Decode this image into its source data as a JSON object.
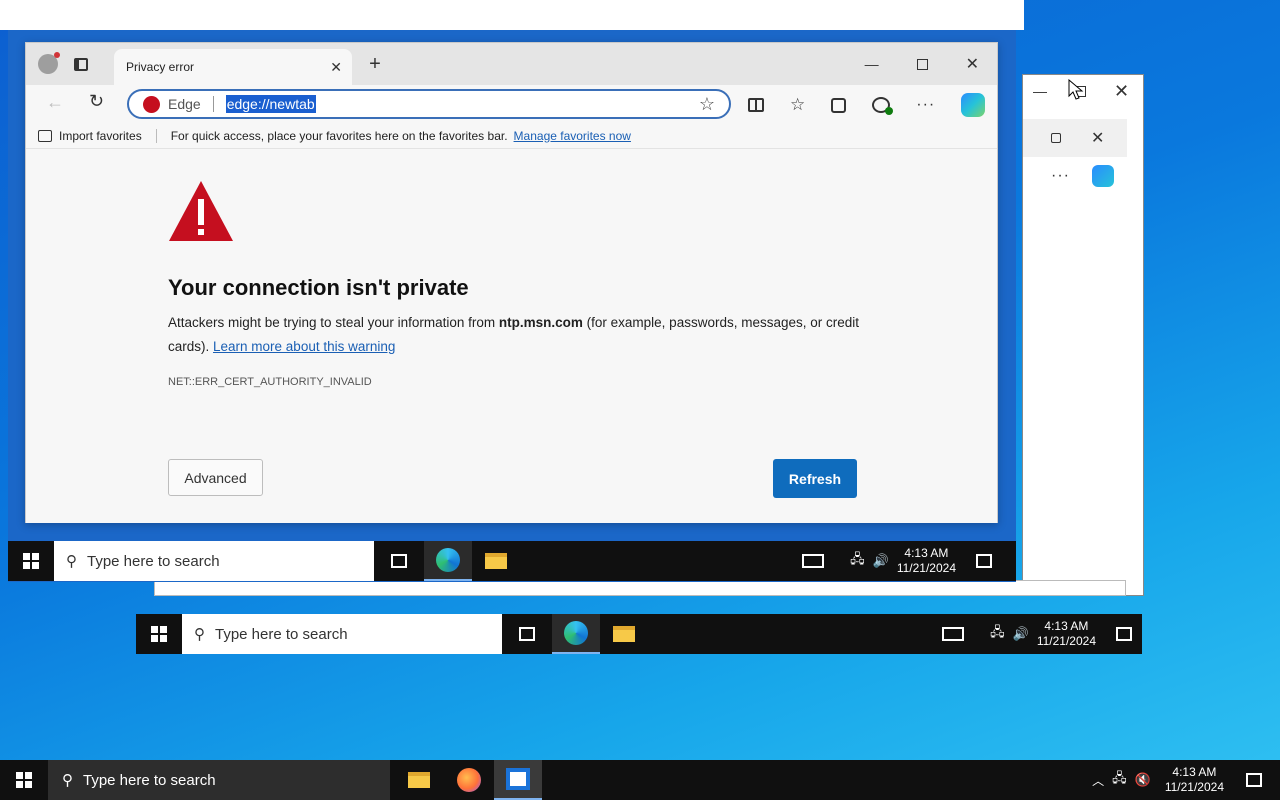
{
  "taskbars": {
    "search_placeholder": "Type here to search",
    "time": "4:13 AM",
    "date": "11/21/2024"
  },
  "browser": {
    "tab_title": "Privacy error",
    "site_label": "Edge",
    "url": "edge://newtab",
    "favbar": {
      "import_label": "Import favorites",
      "hint": "For quick access, place your favorites here on the favorites bar.",
      "manage_link": "Manage favorites now"
    }
  },
  "error_page": {
    "heading": "Your connection isn't private",
    "body_prefix": "Attackers might be trying to steal your information from ",
    "host": "ntp.msn.com",
    "body_suffix": " (for example, passwords, messages, or credit cards). ",
    "learn_more": "Learn more about this warning",
    "error_code": "NET::ERR_CERT_AUTHORITY_INVALID",
    "advanced_label": "Advanced",
    "refresh_label": "Refresh"
  },
  "colors": {
    "accent": "#0f6cbd",
    "warning_red": "#c50f1f",
    "taskbar": "#101010"
  }
}
